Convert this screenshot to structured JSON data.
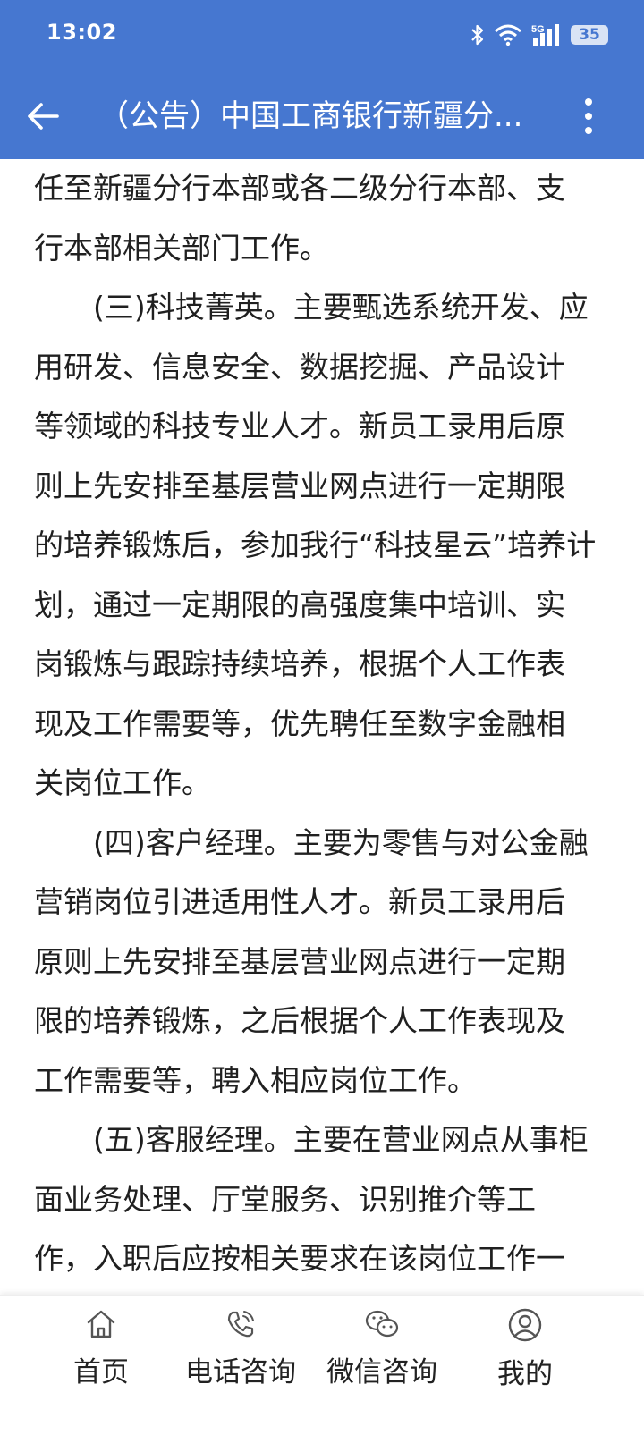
{
  "status_bar": {
    "time": "13:02",
    "network": "5G",
    "battery": "35",
    "icons": [
      "bluetooth-icon",
      "wifi-icon",
      "signal-icon",
      "battery-icon"
    ]
  },
  "toolbar": {
    "title": "（公告）中国工商银行新疆分...",
    "back_icon": "arrow-left-icon",
    "more_icon": "more-vertical-icon"
  },
  "article": {
    "lines": [
      {
        "text": "任至新疆分行本部或各二级分行本部、支",
        "indent": false
      },
      {
        "text": "行本部相关部门工作。",
        "indent": false
      },
      {
        "text": "(三)科技菁英。主要甄选系统开发、应",
        "indent": true
      },
      {
        "text": "用研发、信息安全、数据挖掘、产品设计",
        "indent": false
      },
      {
        "text": "等领域的科技专业人才。新员工录用后原",
        "indent": false
      },
      {
        "text": "则上先安排至基层营业网点进行一定期限",
        "indent": false
      },
      {
        "text": "的培养锻炼后，参加我行“科技星云”培养计",
        "indent": false
      },
      {
        "text": "划，通过一定期限的高强度集中培训、实",
        "indent": false
      },
      {
        "text": "岗锻炼与跟踪持续培养，根据个人工作表",
        "indent": false
      },
      {
        "text": "现及工作需要等，优先聘任至数字金融相",
        "indent": false
      },
      {
        "text": "关岗位工作。",
        "indent": false
      },
      {
        "text": "(四)客户经理。主要为零售与对公金融",
        "indent": true
      },
      {
        "text": "营销岗位引进适用性人才。新员工录用后",
        "indent": false
      },
      {
        "text": "原则上先安排至基层营业网点进行一定期",
        "indent": false
      },
      {
        "text": "限的培养锻炼，之后根据个人工作表现及",
        "indent": false
      },
      {
        "text": "工作需要等，聘入相应岗位工作。",
        "indent": false
      },
      {
        "text": "(五)客服经理。主要在营业网点从事柜",
        "indent": true
      },
      {
        "text": "面业务处理、厅堂服务、识别推介等工",
        "indent": false
      },
      {
        "text": "作，入职后应按相关要求在该岗位工作一",
        "indent": false
      }
    ]
  },
  "bottom_nav": {
    "items": [
      {
        "label": "首页",
        "icon": "home-icon"
      },
      {
        "label": "电话咨询",
        "icon": "phone-icon"
      },
      {
        "label": "微信咨询",
        "icon": "wechat-icon"
      },
      {
        "label": "我的",
        "icon": "user-icon"
      }
    ]
  },
  "colors": {
    "header_bg": "#4677d0",
    "text": "#202020",
    "nav_bg": "#ffffff"
  }
}
